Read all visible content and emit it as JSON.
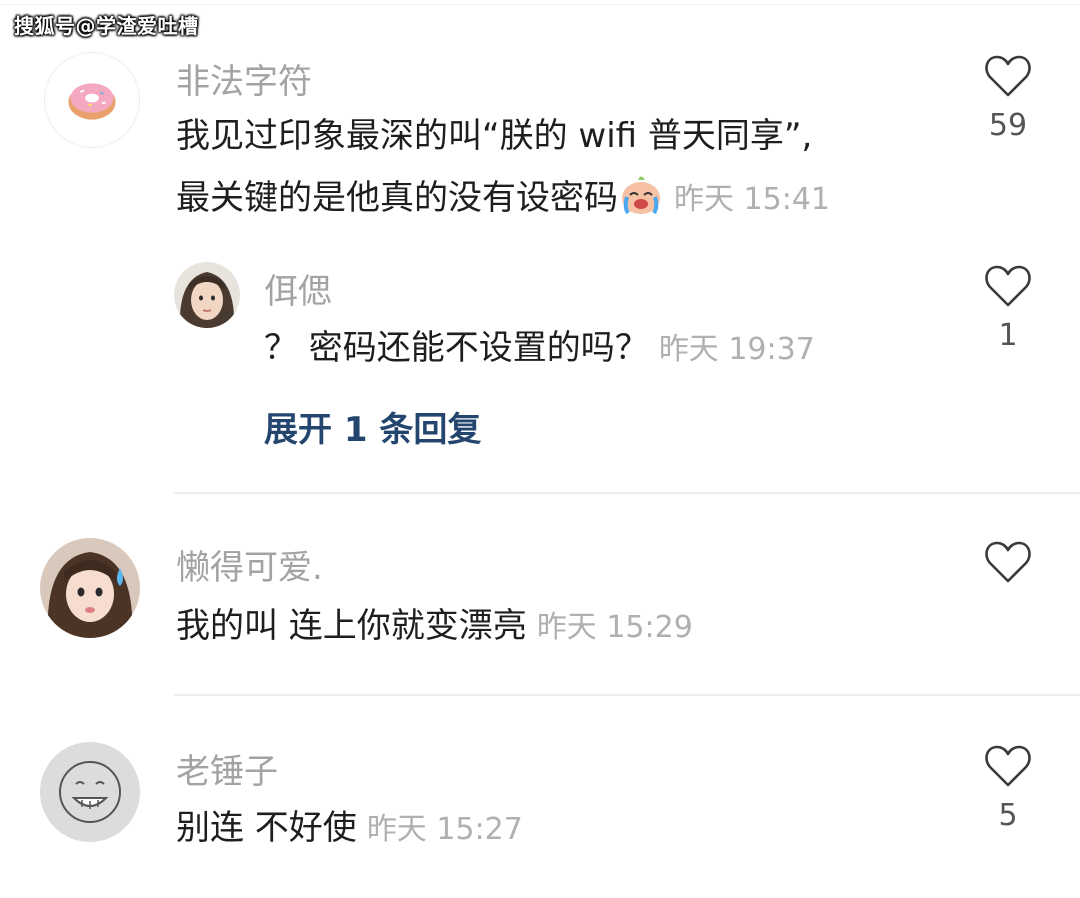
{
  "watermark": "搜狐号@学渣爱吐槽",
  "comments": [
    {
      "username": "非法字符",
      "text_line1": "我见过印象最深的叫“朕的 wifi 普天同享”,",
      "text_line2": "最关键的是他真的没有设密码",
      "time": "昨天 15:41",
      "likes": "59",
      "reply": {
        "username": "佴偲",
        "text": "？ 密码还能不设置的吗？",
        "time": "昨天 19:37",
        "likes": "1"
      },
      "expand_label": "展开 1 条回复"
    },
    {
      "username": "懒得可爱.",
      "text": "我的叫 连上你就变漂亮",
      "time": "昨天 15:29",
      "likes": ""
    },
    {
      "username": "老锤子",
      "text": "别连 不好使",
      "time": "昨天 15:27",
      "likes": "5"
    }
  ],
  "colors": {
    "username": "#a3a3a3",
    "time": "#b0b0b0",
    "expand_link": "#24456e",
    "divider": "#eeeeee"
  }
}
